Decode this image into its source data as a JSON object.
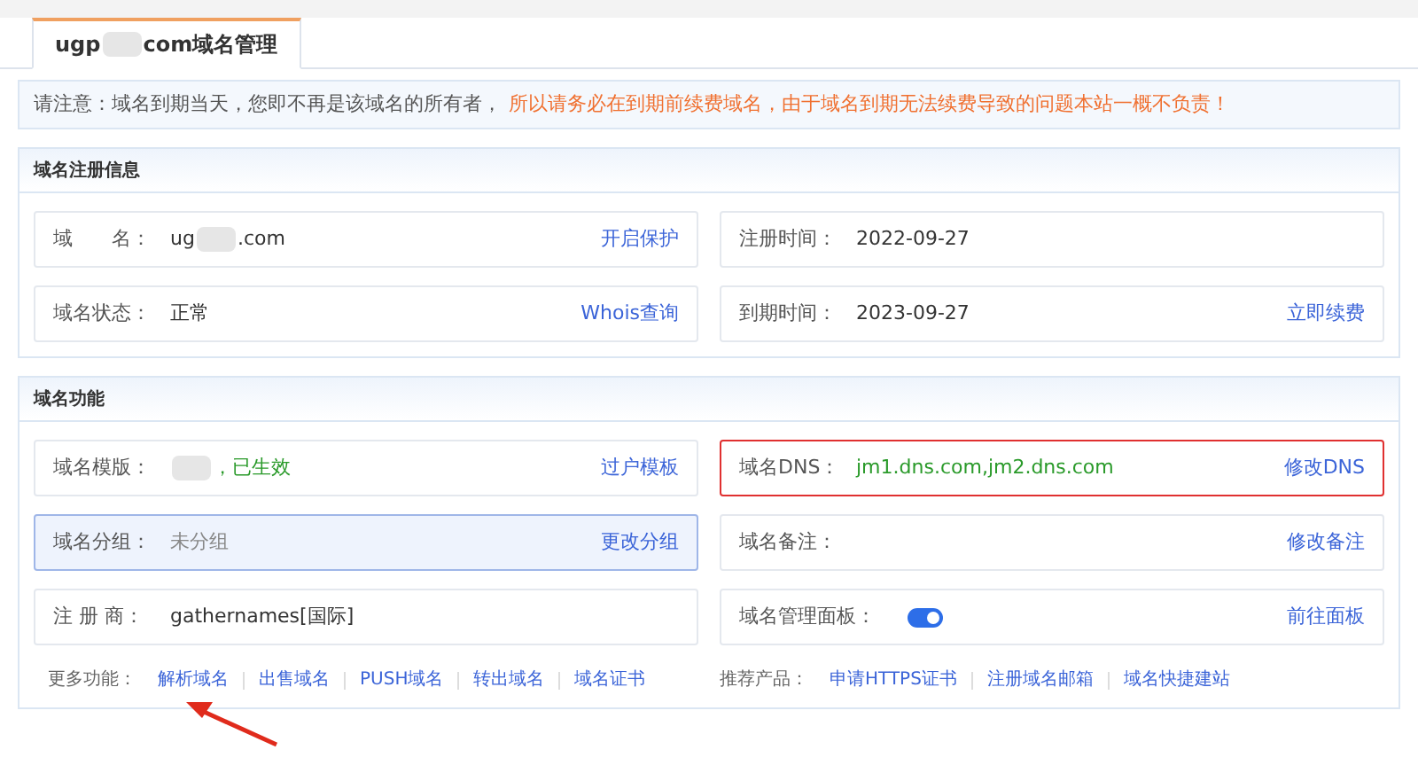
{
  "tab": {
    "before": "ugp",
    "after": "com域名管理",
    "selected": true
  },
  "notice": {
    "text": "请注意：域名到期当天，您即不再是该域名的所有者，",
    "warning": "所以请务必在到期前续费域名，由于域名到期无法续费导致的问题本站一概不负责！"
  },
  "sections": [
    {
      "title": "域名注册信息",
      "cells": [
        {
          "label": "域　　名：",
          "kind": "redacted",
          "before": "ug",
          "after": ".com",
          "action": "开启保护",
          "selected": false,
          "highlighted": false
        },
        {
          "label": "注册时间：",
          "kind": "text",
          "value": "2022-09-27",
          "selected": false,
          "highlighted": false
        },
        {
          "label": "域名状态：",
          "kind": "text",
          "value": "正常",
          "action": "Whois查询",
          "selected": false,
          "highlighted": false
        },
        {
          "label": "到期时间：",
          "kind": "text",
          "value": "2023-09-27",
          "action": "立即续费",
          "selected": false,
          "highlighted": false
        }
      ]
    },
    {
      "title": "域名功能",
      "cells": [
        {
          "label": "域名模版：",
          "kind": "redacted",
          "after": "，已生效",
          "color": "#2a9a2a",
          "action": "过户模板",
          "selected": false,
          "highlighted": false
        },
        {
          "label": "域名DNS：",
          "kind": "text",
          "value": "jm1.dns.com,jm2.dns.com",
          "color": "#2a9a2a",
          "action": "修改DNS",
          "selected": false,
          "highlighted": true
        },
        {
          "label": "域名分组：",
          "kind": "muted",
          "value": "未分组",
          "action": "更改分组",
          "selected": true,
          "highlighted": false
        },
        {
          "label": "域名备注：",
          "kind": "text",
          "action": "修改备注",
          "selected": false,
          "highlighted": false
        },
        {
          "label": "注 册 商：",
          "kind": "text",
          "value": "gathernames[国际]",
          "selected": false,
          "highlighted": false
        },
        {
          "label": "域名管理面板：",
          "kind": "toggle",
          "on": true,
          "action": "前往面板",
          "selected": false,
          "highlighted": false
        }
      ],
      "more": {
        "label": "更多功能：",
        "links": [
          "解析域名",
          "出售域名",
          "PUSH域名",
          "转出域名",
          "域名证书"
        ]
      },
      "recommend": {
        "label": "推荐产品：",
        "links": [
          "申请HTTPS证书",
          "注册域名邮箱",
          "域名快捷建站"
        ]
      }
    }
  ]
}
